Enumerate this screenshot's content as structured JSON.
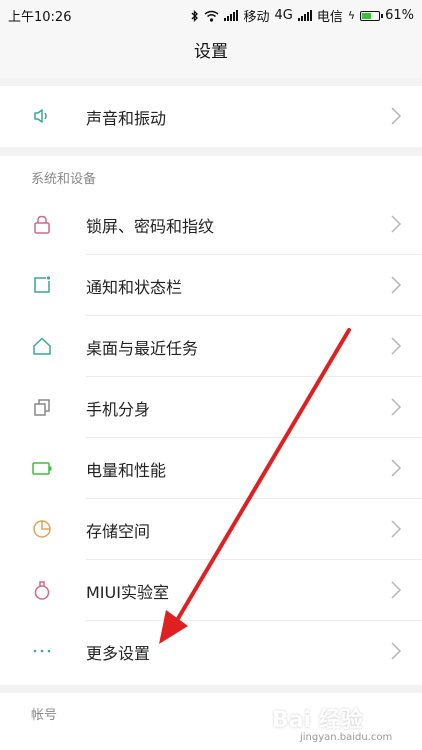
{
  "status": {
    "time": "上午10:26",
    "carrier1": "移动",
    "net": "4G",
    "carrier2": "电信",
    "battery": "61%",
    "battery_level": 0.61
  },
  "title": "设置",
  "rows_top": [
    {
      "label": "声音和振动",
      "icon": "speaker-icon"
    }
  ],
  "section_system": {
    "header": "系统和设备",
    "items": [
      {
        "label": "锁屏、密码和指纹",
        "icon": "lock-icon"
      },
      {
        "label": "通知和状态栏",
        "icon": "notification-icon"
      },
      {
        "label": "桌面与最近任务",
        "icon": "home-icon"
      },
      {
        "label": "手机分身",
        "icon": "clone-icon"
      },
      {
        "label": "电量和性能",
        "icon": "battery-icon"
      },
      {
        "label": "存储空间",
        "icon": "pie-chart-icon"
      },
      {
        "label": "MIUI实验室",
        "icon": "flask-icon"
      },
      {
        "label": "更多设置",
        "icon": "more-icon"
      }
    ]
  },
  "section_account": {
    "header": "帐号"
  },
  "colors": {
    "teal": "#3aa79a",
    "pink": "#d0688a",
    "green": "#3dbf3a",
    "orange": "#e0a35a",
    "annotation": "#e02020"
  },
  "watermark": {
    "text": "Bai 经验",
    "sub": "jingyan.baidu.com"
  }
}
